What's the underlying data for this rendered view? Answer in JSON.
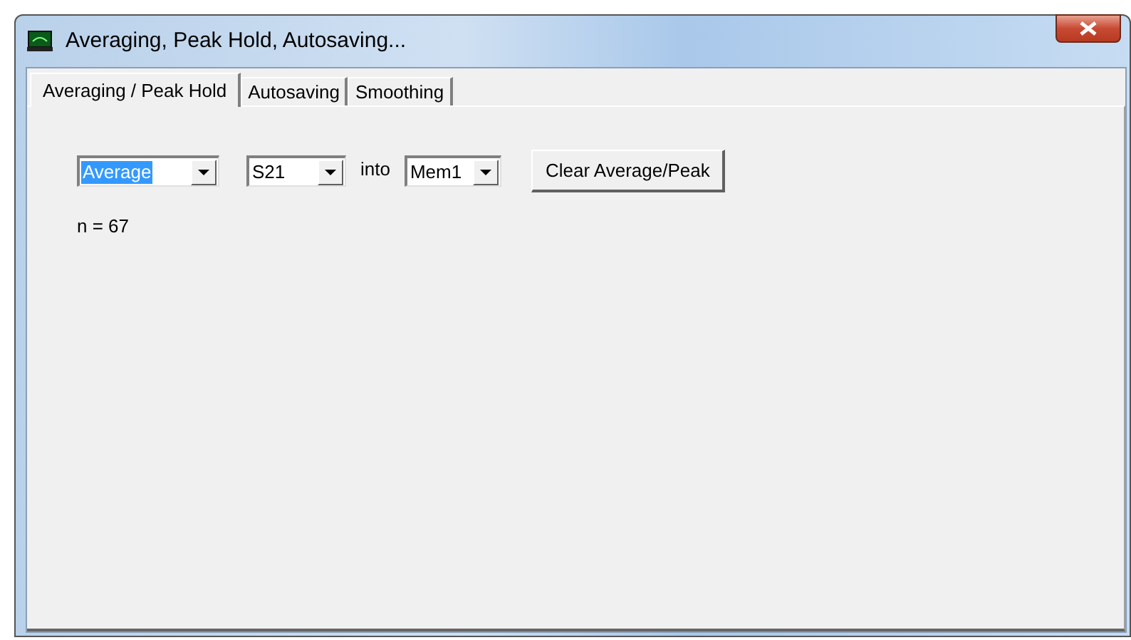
{
  "window": {
    "title": "Averaging, Peak Hold, Autosaving..."
  },
  "tabs": [
    {
      "label": "Averaging / Peak Hold",
      "selected": true
    },
    {
      "label": "Autosaving",
      "selected": false
    },
    {
      "label": "Smoothing",
      "selected": false
    }
  ],
  "mode_dropdown": {
    "value": "Average",
    "highlighted": true
  },
  "parameter_dropdown": {
    "value": "S21",
    "highlighted": false
  },
  "into_label": "into",
  "memory_dropdown": {
    "value": "Mem1",
    "highlighted": false
  },
  "clear_button": {
    "label": "Clear Average/Peak"
  },
  "count_text": "n = 67"
}
